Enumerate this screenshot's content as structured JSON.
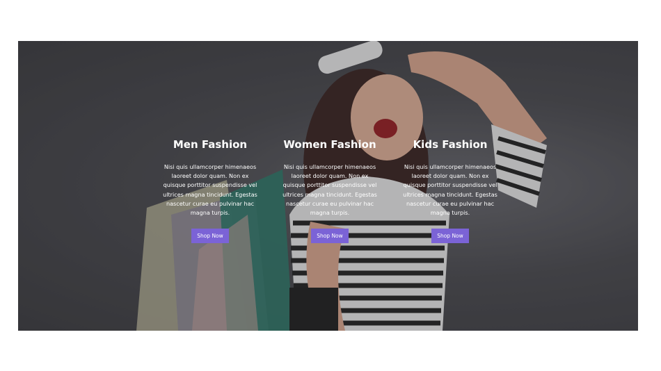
{
  "hero": {
    "columns": [
      {
        "title": "Men Fashion",
        "text": "Nisi quis ullamcorper himenaeos laoreet dolor quam. Non ex quisque porttitor suspendisse vel ultrices magna tincidunt. Egestas nascetur curae eu pulvinar hac magna turpis.",
        "button": "Shop Now"
      },
      {
        "title": "Women Fashion",
        "text": "Nisi quis ullamcorper himenaeos laoreet dolor quam. Non ex quisque porttitor suspendisse vel ultrices magna tincidunt. Egestas nascetur curae eu pulvinar hac magna turpis.",
        "button": "Shop Now"
      },
      {
        "title": "Kids Fashion",
        "text": "Nisi quis ullamcorper himenaeos laoreet dolor quam. Non ex quisque porttitor suspendisse vel ultrices magna tincidunt. Egestas nascetur curae eu pulvinar hac magna turpis.",
        "button": "Shop Now"
      }
    ]
  },
  "colors": {
    "accent": "#7b63d6",
    "overlay": "#3c3c40",
    "text": "#ffffff"
  }
}
